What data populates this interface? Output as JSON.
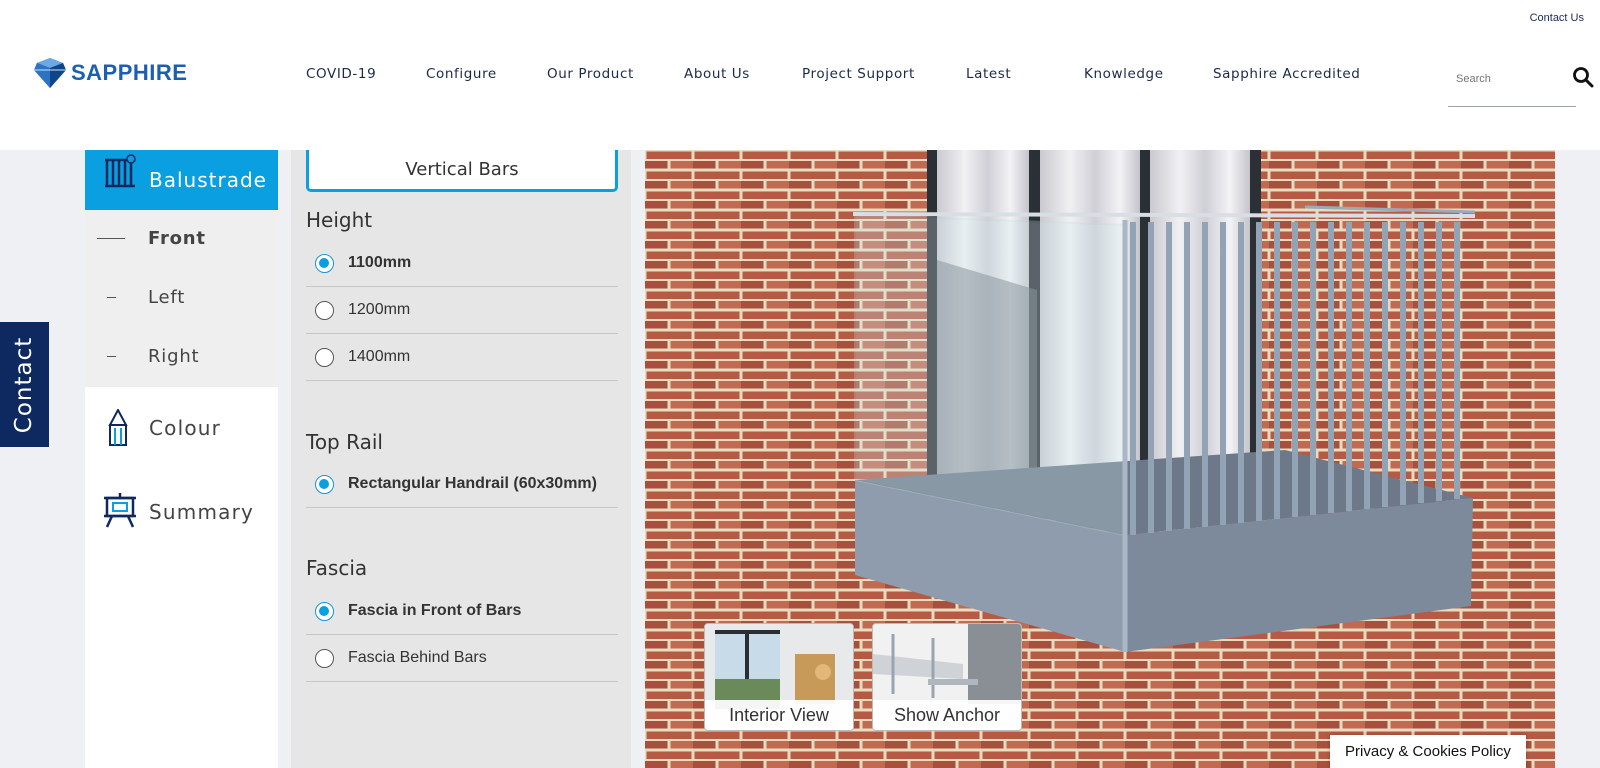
{
  "header": {
    "contact_link": "Contact Us",
    "logo_text": "SAPPHIRE",
    "nav": [
      "COVID-19",
      "Configure",
      "Our Product",
      "About Us",
      "Project Support",
      "Latest",
      "Knowledge",
      "Sapphire Accredited"
    ],
    "search_placeholder": "Search"
  },
  "contact_tab": "Contact",
  "menu": {
    "active": "Balustrade",
    "sub_items": [
      "Front",
      "Left",
      "Right"
    ],
    "items": [
      "Colour",
      "Summary"
    ]
  },
  "options": {
    "vertical_bars": "Vertical Bars",
    "height": {
      "title": "Height",
      "options": [
        "1100mm",
        "1200mm",
        "1400mm"
      ],
      "selected": "1100mm"
    },
    "top_rail": {
      "title": "Top Rail",
      "options": [
        "Rectangular Handrail (60x30mm)"
      ],
      "selected": "Rectangular Handrail (60x30mm)"
    },
    "fascia": {
      "title": "Fascia",
      "options": [
        "Fascia in Front of Bars",
        "Fascia Behind Bars"
      ],
      "selected": "Fascia in Front of Bars"
    }
  },
  "viewer": {
    "interior_view": "Interior View",
    "show_anchor": "Show Anchor"
  },
  "privacy": "Privacy & Cookies Policy",
  "colors": {
    "accent": "#0a9fe0",
    "navy": "#0e2860",
    "brick": "#b65a44",
    "steel": "#8a9bb0"
  }
}
